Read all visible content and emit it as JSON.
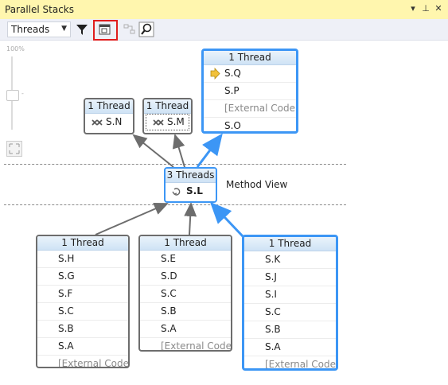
{
  "window": {
    "title": "Parallel Stacks"
  },
  "toolbar": {
    "view_select": "Threads"
  },
  "zoom": {
    "percent_label": "100%",
    "tick_label": "-"
  },
  "canvas": {
    "method_view_label": "Method View"
  },
  "colors": {
    "active_border": "#3c96f5",
    "normal_border": "#6d6d6d",
    "title_bar": "#fff6ae",
    "highlight": "#e01e1e"
  },
  "stacks": {
    "top_right": {
      "header": "1 Thread",
      "frames": [
        "S.Q",
        "S.P",
        "[External Code]",
        "S.O"
      ]
    },
    "top_left_a": {
      "header": "1 Thread",
      "frames": [
        "S.N"
      ]
    },
    "top_left_b": {
      "header": "1 Thread",
      "frames": [
        "S.M"
      ]
    },
    "middle": {
      "header": "3 Threads",
      "frames": [
        "S.L"
      ]
    },
    "bottom_left": {
      "header": "1 Thread",
      "frames": [
        "S.H",
        "S.G",
        "S.F",
        "S.C",
        "S.B",
        "S.A",
        "[External Code]"
      ]
    },
    "bottom_middle": {
      "header": "1 Thread",
      "frames": [
        "S.E",
        "S.D",
        "S.C",
        "S.B",
        "S.A",
        "[External Code]"
      ]
    },
    "bottom_right": {
      "header": "1 Thread",
      "frames": [
        "S.K",
        "S.J",
        "S.I",
        "S.C",
        "S.B",
        "S.A",
        "[External Code]"
      ]
    }
  }
}
